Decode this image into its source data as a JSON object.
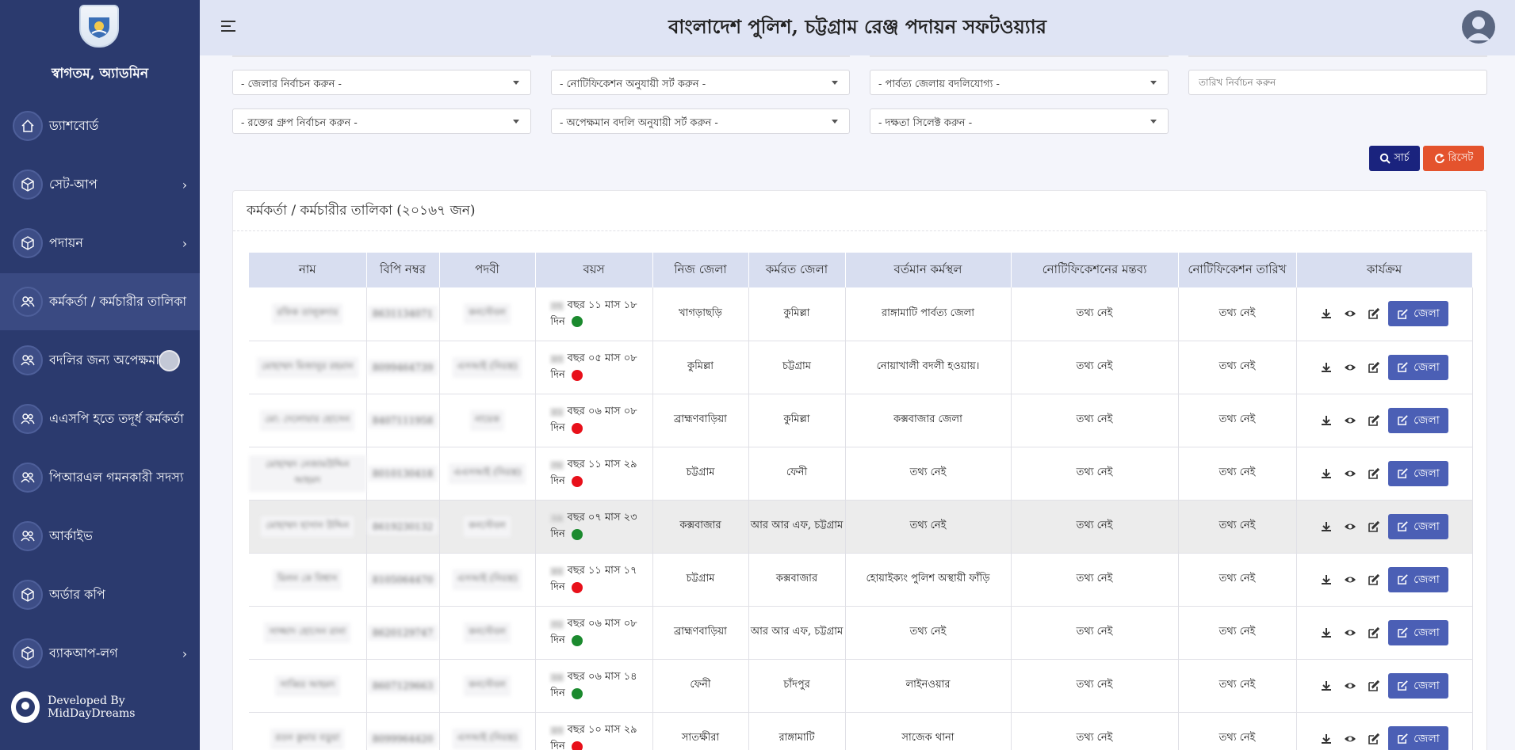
{
  "app": {
    "title": "বাংলাদেশ পুলিশ, চট্টগ্রাম রেঞ্জ পদায়ন সফটওয়্যার"
  },
  "sidebar": {
    "welcome": "স্বাগতম, অ্যাডমিন",
    "items": [
      {
        "label": "ড্যাশবোর্ড",
        "icon": "home-icon"
      },
      {
        "label": "সেট-আপ",
        "icon": "cube-icon",
        "has_submenu": true
      },
      {
        "label": "পদায়ন",
        "icon": "cube-icon",
        "has_submenu": true
      },
      {
        "label": "কর্মকর্তা / কর্মচারীর তালিকা",
        "icon": "users-icon",
        "active": true
      },
      {
        "label": "বদলির জন্য অপেক্ষমান",
        "icon": "users-icon"
      },
      {
        "label": "এএসপি হতে তদূর্ধ কর্মকর্তা",
        "icon": "users-icon"
      },
      {
        "label": "পিআরএল গমনকারী সদস্য",
        "icon": "users-icon"
      },
      {
        "label": "আর্কাইভ",
        "icon": "users-icon"
      },
      {
        "label": "অর্ডার কপি",
        "icon": "cube-icon"
      },
      {
        "label": "ব্যাকআপ-লগ",
        "icon": "cube-icon",
        "has_submenu": true
      }
    ],
    "footer": "Developed By MidDayDreams"
  },
  "filters": {
    "district": "- জেলার নির্বাচন করুন -",
    "notification_sort": "- নোটিফিকেশন অনুযায়ী সর্ট করুন -",
    "hill_transfer": "- পার্বত্য জেলায় বদলিযোগ্য -",
    "date_placeholder": "তারিখ নির্বাচন করুন",
    "blood_group": "- রক্তের গ্রুপ নির্বাচন করুন -",
    "waiting_transfer_sort": "- অপেক্ষমান বদলি অনুযায়ী সর্ট করুন -",
    "skill": "- দক্ষতা সিলেক্ট করুন -",
    "search_label": "সার্চ",
    "reset_label": "রিসেট"
  },
  "table": {
    "title": "কর্মকর্তা / কর্মচারীর তালিকা (২০১৬৭ জন)",
    "headers": [
      "নাম",
      "বিপি নম্বর",
      "পদবী",
      "বয়স",
      "নিজ জেলা",
      "কর্মরত জেলা",
      "বর্তমান কর্মস্থল",
      "নোটিফিকেশনের মন্তব্য",
      "নোটিফিকেশন তারিখ",
      "কার্যক্রম"
    ],
    "action_label": "জেলা",
    "colors": {
      "green": "#1b8a2e",
      "red": "#e8101a"
    },
    "rows": [
      {
        "name": "রফিক তালুকদার",
        "bp": "8631134071",
        "rank": "কনস্টেবল",
        "age_years": "৩৭",
        "age_text": "বছর ১১ মাস ১৮",
        "age_day": "দিন",
        "status": "green",
        "home": "খাগড়াছড়ি",
        "work": "কুমিল্লা",
        "current": "রাঙ্গামাটি পার্বত্য জেলা",
        "note": "তথ্য নেই",
        "date": "তথ্য নেই"
      },
      {
        "name": "মোহাম্মদ মিজানুর রহমান",
        "bp": "8099464739",
        "rank": "এসআই (নিরস্ত্র)",
        "age_years": "৪৩",
        "age_text": "বছর ০৫ মাস ০৮",
        "age_day": "দিন",
        "status": "red",
        "home": "কুমিল্লা",
        "work": "চট্টগ্রাম",
        "current": "নোয়াখালী বদলী হওয়ায়।",
        "note": "তথ্য নেই",
        "date": "তথ্য নেই"
      },
      {
        "name": "মো: দেলোয়ার হোসেন",
        "bp": "8407111958",
        "rank": "নায়েক",
        "age_years": "৫১",
        "age_text": "বছর ০৬ মাস ০৮",
        "age_day": "দিন",
        "status": "red",
        "home": "ব্রাহ্মণবাড়িয়া",
        "work": "কুমিল্লা",
        "current": "কক্সবাজার জেলা",
        "note": "তথ্য নেই",
        "date": "তথ্য নেই"
      },
      {
        "name": "মোহাম্মদ নেজামউদ্দিন আহমদ",
        "bp": "8010130418",
        "rank": "এএসআই (নিরস্ত্র)",
        "age_years": "৩৮",
        "age_text": "বছর ১১ মাস ২৯",
        "age_day": "দিন",
        "status": "red",
        "home": "চট্টগ্রাম",
        "work": "ফেনী",
        "current": "তথ্য নেই",
        "note": "তথ্য নেই",
        "date": "তথ্য নেই"
      },
      {
        "name": "মোহাম্মদ হাসান উদ্দিন",
        "bp": "8619230132",
        "rank": "কনস্টেবল",
        "age_years": "২৯",
        "age_text": "বছর ০৭ মাস ২৩",
        "age_day": "দিন",
        "status": "green",
        "home": "কক্সবাজার",
        "work": "আর আর এফ, চট্টগ্রাম",
        "current": "তথ্য নেই",
        "note": "তথ্য নেই",
        "date": "তথ্য নেই",
        "highlight": true
      },
      {
        "name": "মিলন কে বিশ্বাস",
        "bp": "8105064470",
        "rank": "এসআই (নিরস্ত্র)",
        "age_years": "৪২",
        "age_text": "বছর ১১ মাস ১৭",
        "age_day": "দিন",
        "status": "red",
        "home": "চট্টগ্রাম",
        "work": "কক্সবাজার",
        "current": "হোয়াইক্যং পুলিশ অস্থায়ী ফাঁড়ি",
        "note": "তথ্য নেই",
        "date": "তথ্য নেই"
      },
      {
        "name": "সাজ্জাদ হোসেন রানা",
        "bp": "8620129747",
        "rank": "কনস্টেবল",
        "age_years": "৩১",
        "age_text": "বছর ০৬ মাস ০৮",
        "age_day": "দিন",
        "status": "green",
        "home": "ব্রাহ্মণবাড়িয়া",
        "work": "আর আর এফ, চট্টগ্রাম",
        "current": "তথ্য নেই",
        "note": "তথ্য নেই",
        "date": "তথ্য নেই"
      },
      {
        "name": "সাব্বির আহমদ",
        "bp": "8607129663",
        "rank": "কনস্টেবল",
        "age_years": "২৬",
        "age_text": "বছর ০৬ মাস ১৪",
        "age_day": "দিন",
        "status": "green",
        "home": "ফেনী",
        "work": "চাঁদপুর",
        "current": "লাইনওয়ার",
        "note": "তথ্য নেই",
        "date": "তথ্য নেই"
      },
      {
        "name": "রতন কুমার বড়ুয়া",
        "bp": "8099964420",
        "rank": "এসআই (নিরস্ত্র)",
        "age_years": "৫৩",
        "age_text": "বছর ১০ মাস ২৯",
        "age_day": "দিন",
        "status": "red",
        "home": "সাতক্ষীরা",
        "work": "রাঙ্গামাটি",
        "current": "সাজেক থানা",
        "note": "তথ্য নেই",
        "date": "তথ্য নেই"
      }
    ]
  }
}
